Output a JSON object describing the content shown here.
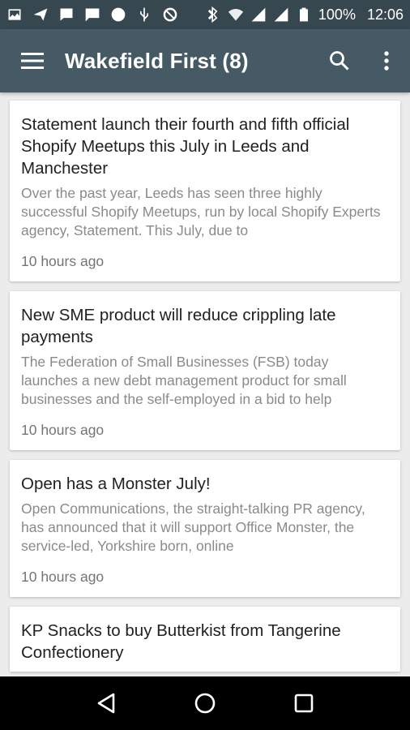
{
  "status_bar": {
    "battery": "100%",
    "time": "12:06",
    "icons": [
      "image-icon",
      "send-icon",
      "message-icon",
      "chat-icon",
      "circle-icon",
      "usb-icon",
      "blocked-icon",
      "bluetooth-icon",
      "wifi-icon",
      "signal-icon",
      "signal-icon",
      "battery-icon"
    ]
  },
  "app_bar": {
    "title": "Wakefield First (8)",
    "menu_icon": "menu-icon",
    "search_icon": "search-icon",
    "more_icon": "more-vert-icon"
  },
  "articles": [
    {
      "title": "Statement launch their fourth and fifth official Shopify Meetups this July in Leeds and Manchester",
      "excerpt": "Over the past year, Leeds has seen three highly successful Shopify Meetups, run by local Shopify Experts agency, Statement.  This July, due to",
      "time": "10 hours ago"
    },
    {
      "title": "New SME product will reduce crippling late payments",
      "excerpt": "The Federation of Small Businesses (FSB) today launches a new debt management product for small businesses and the self-employed in a bid to help",
      "time": "10 hours ago"
    },
    {
      "title": "Open has a Monster July!",
      "excerpt": "Open Communications, the straight-talking PR agency, has announced that it will support Office Monster, the service-led, Yorkshire born, online",
      "time": "10 hours ago"
    },
    {
      "title": "KP Snacks to buy Butterkist from Tangerine Confectionery"
    }
  ],
  "nav_bar": {
    "back_icon": "back-icon",
    "home_icon": "home-icon",
    "recents_icon": "recents-icon"
  },
  "colors": {
    "status_bar": "#37474f",
    "app_bar": "#455a64",
    "background": "#ececec",
    "card": "#ffffff",
    "title_text": "#212121",
    "excerpt_text": "#8a8a8a"
  }
}
